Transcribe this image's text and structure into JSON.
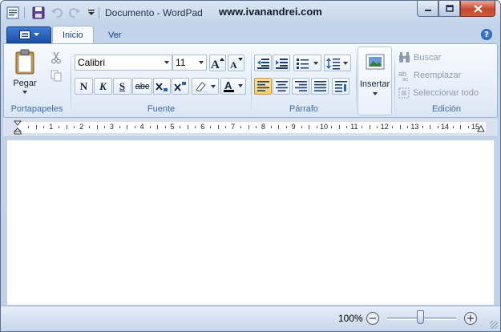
{
  "window": {
    "title": "Documento - WordPad",
    "watermark": "www.ivanandrei.com"
  },
  "colors": {
    "accent": "#1a4fa8",
    "close_button": "#c6472b",
    "ribbon_label": "#3e6aaa",
    "active_toggle": "#ffcf5f"
  },
  "quick_access": [
    "app-icon",
    "save-icon",
    "undo-icon",
    "redo-icon",
    "customize-icon"
  ],
  "tabs": [
    {
      "label": "Inicio",
      "active": true
    },
    {
      "label": "Ver",
      "active": false
    }
  ],
  "ribbon": {
    "clipboard": {
      "label": "Portapapeles",
      "paste_label": "Pegar"
    },
    "font": {
      "label": "Fuente",
      "family": "Calibri",
      "size": "11",
      "bold": "N",
      "italic": "K",
      "underline": "S",
      "strikethrough": "abc"
    },
    "paragraph": {
      "label": "Párrafo"
    },
    "insert": {
      "label": "Insertar"
    },
    "edit": {
      "label": "Edición",
      "find": "Buscar",
      "replace": "Reemplazar",
      "select_all": "Seleccionar todo"
    }
  },
  "ruler": {
    "numbers": [
      "1",
      "2",
      "3",
      "4",
      "5",
      "6",
      "7",
      "8",
      "9",
      "10",
      "11",
      "12",
      "13",
      "14",
      "15"
    ]
  },
  "status": {
    "zoom": "100%"
  }
}
